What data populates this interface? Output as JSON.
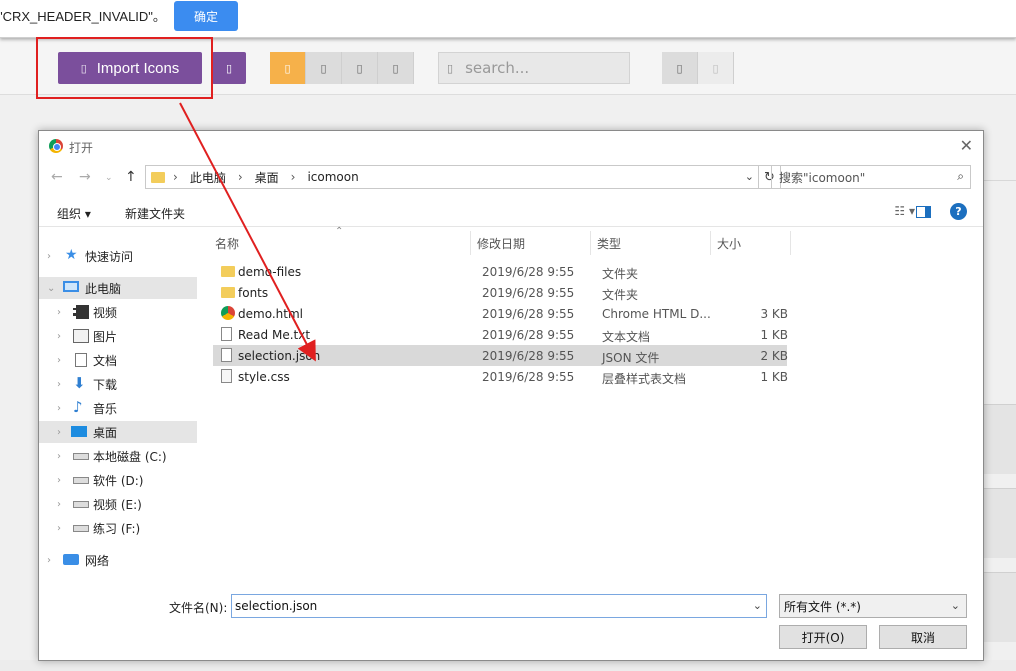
{
  "topbar": {
    "error_text": "\"CRX_HEADER_INVALID\"。",
    "ok_label": "确定"
  },
  "toolbar": {
    "import_label": "Import Icons",
    "search_placeholder": "search..."
  },
  "colors": {
    "import_purple": "#7b4f9c",
    "active_orange": "#f6b14a",
    "highlight_red": "#e02020",
    "ok_blue": "#3b8cf0"
  },
  "dialog": {
    "title": "打开",
    "breadcrumb": [
      "此电脑",
      "桌面",
      "icomoon"
    ],
    "search_placeholder": "搜索\"icomoon\"",
    "commands": {
      "organize": "组织",
      "new_folder": "新建文件夹"
    },
    "tree": [
      {
        "label": "快速访问",
        "icon": "star-icon"
      },
      {
        "label": "此电脑",
        "icon": "computer-icon"
      },
      {
        "label": "视频",
        "icon": "video-icon"
      },
      {
        "label": "图片",
        "icon": "picture-icon"
      },
      {
        "label": "文档",
        "icon": "document-icon"
      },
      {
        "label": "下载",
        "icon": "download-icon"
      },
      {
        "label": "音乐",
        "icon": "music-icon"
      },
      {
        "label": "桌面",
        "icon": "desktop-icon"
      },
      {
        "label": "本地磁盘 (C:)",
        "icon": "disk-icon"
      },
      {
        "label": "软件 (D:)",
        "icon": "disk-icon"
      },
      {
        "label": "视频 (E:)",
        "icon": "disk-icon"
      },
      {
        "label": "练习 (F:)",
        "icon": "disk-icon"
      },
      {
        "label": "网络",
        "icon": "network-icon"
      }
    ],
    "columns": [
      "名称",
      "修改日期",
      "类型",
      "大小"
    ],
    "files": [
      {
        "name": "demo-files",
        "date": "2019/6/28 9:55",
        "type": "文件夹",
        "size": "",
        "icon": "folder-icon"
      },
      {
        "name": "fonts",
        "date": "2019/6/28 9:55",
        "type": "文件夹",
        "size": "",
        "icon": "folder-icon"
      },
      {
        "name": "demo.html",
        "date": "2019/6/28 9:55",
        "type": "Chrome HTML D...",
        "size": "3 KB",
        "icon": "chrome-icon"
      },
      {
        "name": "Read Me.txt",
        "date": "2019/6/28 9:55",
        "type": "文本文档",
        "size": "1 KB",
        "icon": "text-file-icon"
      },
      {
        "name": "selection.json",
        "date": "2019/6/28 9:55",
        "type": "JSON 文件",
        "size": "2 KB",
        "icon": "json-file-icon"
      },
      {
        "name": "style.css",
        "date": "2019/6/28 9:55",
        "type": "层叠样式表文档",
        "size": "1 KB",
        "icon": "css-file-icon"
      }
    ],
    "filename_label": "文件名(N):",
    "filename_value": "selection.json",
    "filetype_value": "所有文件 (*.*)",
    "open_label": "打开(O)",
    "cancel_label": "取消"
  }
}
